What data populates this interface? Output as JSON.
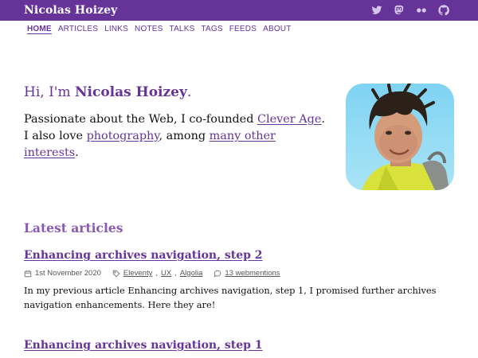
{
  "header": {
    "site_title": "Nicolas Hoizey",
    "social": [
      {
        "name": "twitter-icon"
      },
      {
        "name": "mastodon-icon"
      },
      {
        "name": "flickr-icon"
      },
      {
        "name": "github-icon"
      }
    ],
    "bar_color": "#663399"
  },
  "nav": {
    "items": [
      {
        "label": "HOME",
        "active": true
      },
      {
        "label": "ARTICLES"
      },
      {
        "label": "LINKS"
      },
      {
        "label": "NOTES"
      },
      {
        "label": "TALKS"
      },
      {
        "label": "TAGS"
      },
      {
        "label": "FEEDS"
      },
      {
        "label": "ABOUT"
      }
    ]
  },
  "intro": {
    "greeting_prefix": "Hi, I'm ",
    "name": "Nicolas Hoizey",
    "greeting_suffix": ".",
    "line1_prefix": "Passionate about the Web, I co-founded ",
    "line1_link": "Clever Age",
    "line1_suffix": ".",
    "line2_prefix": "I also love ",
    "line2_link1": "photography",
    "line2_mid": ", among ",
    "line2_link2": "many other interests",
    "line2_suffix": "."
  },
  "latest": {
    "heading": "Latest articles",
    "articles": [
      {
        "title": "Enhancing archives navigation, step 2",
        "date": "1st November 2020",
        "tags": [
          "Eleventy",
          "UX",
          "Algolia"
        ],
        "webmentions": "13 webmentions",
        "excerpt": "In my previous article Enhancing archives navigation, step 1, I promised further archives navigation enhancements. Here they are!"
      },
      {
        "title": "Enhancing archives navigation, step 1"
      }
    ]
  }
}
